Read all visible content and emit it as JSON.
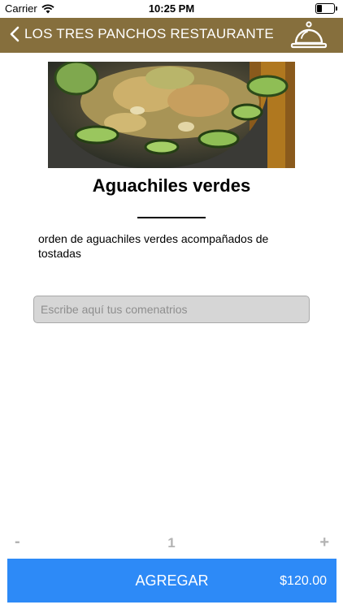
{
  "status_bar": {
    "carrier": "Carrier",
    "time": "10:25 PM"
  },
  "nav": {
    "title": "LOS TRES PANCHOS RESTAURANTE",
    "back_icon": "chevron-left-icon",
    "action_icon": "service-bell-icon"
  },
  "item": {
    "name": "Aguachiles verdes",
    "description": "orden de aguachiles verdes acompañados de tostadas"
  },
  "comments": {
    "placeholder": "Escribe aquí tus comenatrios",
    "value": ""
  },
  "quantity": {
    "minus": "-",
    "value": "1",
    "plus": "+"
  },
  "add_bar": {
    "label": "AGREGAR",
    "price": "$120.00"
  },
  "colors": {
    "nav": "#866f3d",
    "button": "#2d8af7"
  }
}
